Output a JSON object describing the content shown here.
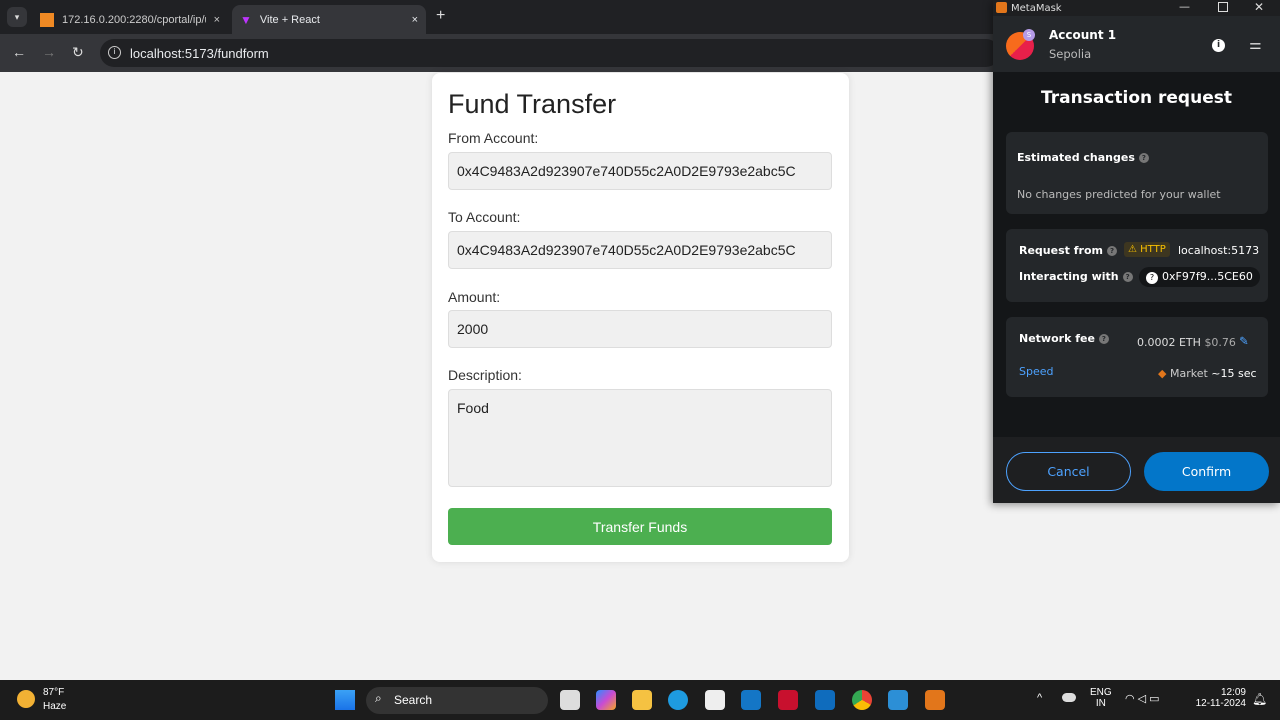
{
  "browser": {
    "tabs": [
      {
        "label": "172.16.0.200:2280/cportal/ip/u"
      },
      {
        "label": "Vite + React"
      }
    ],
    "url": "localhost:5173/fundform",
    "new_tab": "+",
    "close": "×"
  },
  "form": {
    "title": "Fund Transfer",
    "from_label": "From Account:",
    "from_value": "0x4C9483A2d923907e740D55c2A0D2E9793e2abc5C",
    "to_label": "To Account:",
    "to_value": "0x4C9483A2d923907e740D55c2A0D2E9793e2abc5C",
    "amount_label": "Amount:",
    "amount_value": "2000",
    "desc_label": "Description:",
    "desc_value": "Food",
    "submit": "Transfer Funds"
  },
  "metamask": {
    "window_title": "MetaMask",
    "account": "Account 1",
    "network": "Sepolia",
    "avatar_badge": "S",
    "heading": "Transaction request",
    "estimated_changes": "Estimated changes",
    "no_changes": "No changes predicted for your wallet",
    "request_from_label": "Request from",
    "http_badge": "HTTP",
    "request_from": "localhost:5173",
    "interacting_label": "Interacting with",
    "interacting": "0xF97f9...5CE60",
    "fee_label": "Network fee",
    "fee_eth": "0.0002 ETH",
    "fee_usd": "$0.76",
    "speed_label": "Speed",
    "speed_value": "Market",
    "speed_time": "~15 sec",
    "cancel": "Cancel",
    "confirm": "Confirm",
    "accent": "#4da2ff",
    "confirm_bg": "#0376c9"
  },
  "taskbar": {
    "temp": "87°F",
    "weather": "Haze",
    "search": "Search",
    "lang1": "ENG",
    "lang2": "IN",
    "time": "12:09",
    "date": "12-11-2024"
  }
}
